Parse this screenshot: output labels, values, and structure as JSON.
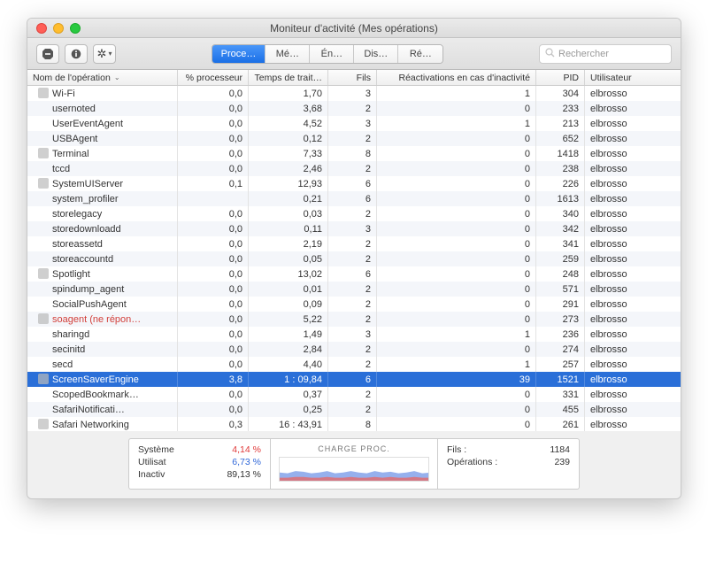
{
  "window_title": "Moniteur d'activité (Mes opérations)",
  "toolbar": {
    "tabs": [
      "Proce…",
      "Mé…",
      "Én…",
      "Dis…",
      "Ré…"
    ],
    "active_tab": 0,
    "search_placeholder": "Rechercher"
  },
  "columns": {
    "name": "Nom de l'opération",
    "cpu": "% processeur",
    "time": "Temps de trait…",
    "threads": "Fils",
    "idle": "Réactivations en cas d'inactivité",
    "pid": "PID",
    "user": "Utilisateur"
  },
  "rows": [
    {
      "name": "Wi-Fi",
      "cpu": "0,0",
      "time": "1,70",
      "threads": "3",
      "idle": "1",
      "pid": "304",
      "user": "elbrosso",
      "icon": "wifi"
    },
    {
      "name": "usernoted",
      "cpu": "0,0",
      "time": "3,68",
      "threads": "2",
      "idle": "0",
      "pid": "233",
      "user": "elbrosso"
    },
    {
      "name": "UserEventAgent",
      "cpu": "0,0",
      "time": "4,52",
      "threads": "3",
      "idle": "1",
      "pid": "213",
      "user": "elbrosso"
    },
    {
      "name": "USBAgent",
      "cpu": "0,0",
      "time": "0,12",
      "threads": "2",
      "idle": "0",
      "pid": "652",
      "user": "elbrosso"
    },
    {
      "name": "Terminal",
      "cpu": "0,0",
      "time": "7,33",
      "threads": "8",
      "idle": "0",
      "pid": "1418",
      "user": "elbrosso",
      "icon": "terminal"
    },
    {
      "name": "tccd",
      "cpu": "0,0",
      "time": "2,46",
      "threads": "2",
      "idle": "0",
      "pid": "238",
      "user": "elbrosso"
    },
    {
      "name": "SystemUIServer",
      "cpu": "0,1",
      "time": "12,93",
      "threads": "6",
      "idle": "0",
      "pid": "226",
      "user": "elbrosso",
      "icon": "app"
    },
    {
      "name": "system_profiler",
      "cpu": "",
      "time": "0,21",
      "threads": "6",
      "idle": "0",
      "pid": "1613",
      "user": "elbrosso"
    },
    {
      "name": "storelegacy",
      "cpu": "0,0",
      "time": "0,03",
      "threads": "2",
      "idle": "0",
      "pid": "340",
      "user": "elbrosso"
    },
    {
      "name": "storedownloadd",
      "cpu": "0,0",
      "time": "0,11",
      "threads": "3",
      "idle": "0",
      "pid": "342",
      "user": "elbrosso"
    },
    {
      "name": "storeassetd",
      "cpu": "0,0",
      "time": "2,19",
      "threads": "2",
      "idle": "0",
      "pid": "341",
      "user": "elbrosso"
    },
    {
      "name": "storeaccountd",
      "cpu": "0,0",
      "time": "0,05",
      "threads": "2",
      "idle": "0",
      "pid": "259",
      "user": "elbrosso"
    },
    {
      "name": "Spotlight",
      "cpu": "0,0",
      "time": "13,02",
      "threads": "6",
      "idle": "0",
      "pid": "248",
      "user": "elbrosso",
      "icon": "spotlight"
    },
    {
      "name": "spindump_agent",
      "cpu": "0,0",
      "time": "0,01",
      "threads": "2",
      "idle": "0",
      "pid": "571",
      "user": "elbrosso"
    },
    {
      "name": "SocialPushAgent",
      "cpu": "0,0",
      "time": "0,09",
      "threads": "2",
      "idle": "0",
      "pid": "291",
      "user": "elbrosso"
    },
    {
      "name": "soagent (ne répon…",
      "cpu": "0,0",
      "time": "5,22",
      "threads": "2",
      "idle": "0",
      "pid": "273",
      "user": "elbrosso",
      "red": true,
      "icon": "app"
    },
    {
      "name": "sharingd",
      "cpu": "0,0",
      "time": "1,49",
      "threads": "3",
      "idle": "1",
      "pid": "236",
      "user": "elbrosso"
    },
    {
      "name": "secinitd",
      "cpu": "0,0",
      "time": "2,84",
      "threads": "2",
      "idle": "0",
      "pid": "274",
      "user": "elbrosso"
    },
    {
      "name": "secd",
      "cpu": "0,0",
      "time": "4,40",
      "threads": "2",
      "idle": "1",
      "pid": "257",
      "user": "elbrosso"
    },
    {
      "name": "ScreenSaverEngine",
      "cpu": "3,8",
      "time": "1 : 09,84",
      "threads": "6",
      "idle": "39",
      "pid": "1521",
      "user": "elbrosso",
      "selected": true,
      "icon": "screensaver"
    },
    {
      "name": "ScopedBookmark…",
      "cpu": "0,0",
      "time": "0,37",
      "threads": "2",
      "idle": "0",
      "pid": "331",
      "user": "elbrosso"
    },
    {
      "name": "SafariNotificati…",
      "cpu": "0,0",
      "time": "0,25",
      "threads": "2",
      "idle": "0",
      "pid": "455",
      "user": "elbrosso"
    },
    {
      "name": "Safari Networking",
      "cpu": "0,3",
      "time": "16 : 43,91",
      "threads": "8",
      "idle": "0",
      "pid": "261",
      "user": "elbrosso",
      "icon": "safari"
    }
  ],
  "footer": {
    "left": {
      "system_label": "Système",
      "system_value": "4,14 %",
      "user_label": "Utilisat",
      "user_value": "6,73 %",
      "idle_label": "Inactiv",
      "idle_value": "89,13 %"
    },
    "mid_title": "CHARGE PROC.",
    "right": {
      "threads_label": "Fils :",
      "threads_value": "1184",
      "ops_label": "Opérations :",
      "ops_value": "239"
    }
  },
  "chart_data": {
    "type": "area",
    "title": "CHARGE PROC.",
    "series": [
      {
        "name": "Système",
        "color": "#e03a3a",
        "values": [
          4,
          4,
          5,
          5,
          4,
          4,
          5,
          4,
          4,
          5,
          4,
          4,
          5,
          4,
          5,
          4,
          4,
          5,
          4,
          4
        ]
      },
      {
        "name": "Utilisat",
        "color": "#3168d8",
        "values": [
          7,
          6,
          8,
          7,
          6,
          7,
          8,
          6,
          7,
          8,
          7,
          6,
          8,
          7,
          7,
          6,
          7,
          8,
          6,
          7
        ]
      }
    ],
    "ylim": [
      0,
      100
    ]
  }
}
